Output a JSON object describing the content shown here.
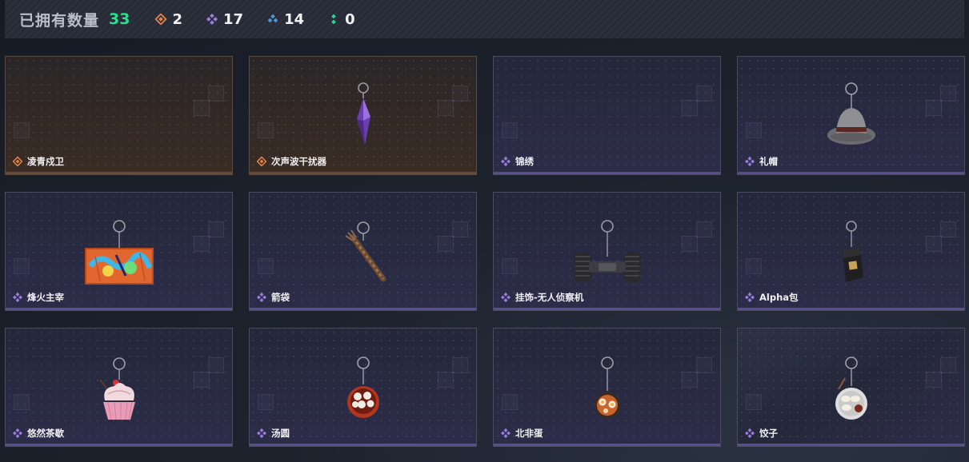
{
  "header": {
    "title": "已拥有数量",
    "total": "33",
    "stats": [
      {
        "icon": "orange-rarity-icon",
        "color": "#e3834a",
        "value": "2"
      },
      {
        "icon": "purple-rarity-icon",
        "color": "#9a7ee0",
        "value": "17"
      },
      {
        "icon": "blue-rarity-icon",
        "color": "#4f97d6",
        "value": "14"
      },
      {
        "icon": "green-rarity-icon",
        "color": "#2bd79a",
        "value": "0"
      }
    ]
  },
  "colors": {
    "accent_green": "#28e18f",
    "rarity_orange": "#e3834a",
    "rarity_purple": "#9a7ee0"
  },
  "items": [
    {
      "name": "凌青戍卫",
      "rarity": "orange",
      "icon": "none"
    },
    {
      "name": "次声波干扰器",
      "rarity": "orange",
      "icon": "purple-crystal-pendant-icon"
    },
    {
      "name": "锦绣",
      "rarity": "purple",
      "icon": "none"
    },
    {
      "name": "礼帽",
      "rarity": "purple",
      "icon": "fedora-hat-charm-icon"
    },
    {
      "name": "烽火主宰",
      "rarity": "purple",
      "icon": "graffiti-container-charm-icon"
    },
    {
      "name": "箭袋",
      "rarity": "purple",
      "icon": "quiver-charm-icon"
    },
    {
      "name": "挂饰-无人侦察机",
      "rarity": "purple",
      "icon": "recon-drone-charm-icon"
    },
    {
      "name": "Alpha包",
      "rarity": "purple",
      "icon": "alpha-pack-charm-icon"
    },
    {
      "name": "悠然茶歇",
      "rarity": "purple",
      "icon": "cupcake-charm-icon"
    },
    {
      "name": "汤圆",
      "rarity": "purple",
      "icon": "tangyuan-bowl-charm-icon"
    },
    {
      "name": "北非蛋",
      "rarity": "purple",
      "icon": "shakshuka-pan-charm-icon"
    },
    {
      "name": "饺子",
      "rarity": "purple",
      "icon": "dumpling-plate-charm-icon"
    }
  ]
}
